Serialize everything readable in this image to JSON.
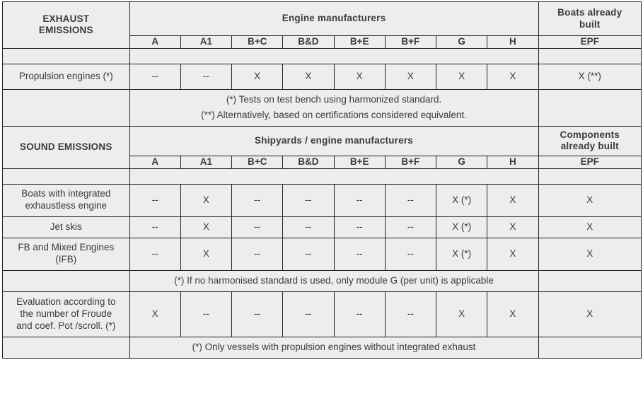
{
  "colors": {
    "header_green": "#2aa048",
    "cell_background": "#eceded",
    "border": "#231f20",
    "text": "#3b3b3b",
    "header_text": "#ffffff"
  },
  "modules": [
    "A",
    "A1",
    "B+C",
    "B&D",
    "B+E",
    "B+F",
    "G",
    "H"
  ],
  "already_built_module": "EPF",
  "section_exhaust": {
    "title": "EXHAUST\nEMISSIONS",
    "title_line1": "EXHAUST",
    "title_line2": "EMISSIONS",
    "group_header": "Engine manufacturers",
    "already_built_header_line1": "Boats already",
    "already_built_header_line2": "built",
    "rows": [
      {
        "label": "Propulsion engines (*)",
        "values": [
          "--",
          "--",
          "X",
          "X",
          "X",
          "X",
          "X",
          "X"
        ],
        "epf": "X (**)"
      }
    ],
    "notes": [
      "(*) Tests on test bench using harmonized standard.",
      "(**) Alternatively, based on certifications considered equivalent."
    ]
  },
  "section_sound": {
    "title": "SOUND EMISSIONS",
    "group_header": "Shipyards / engine manufacturers",
    "already_built_header_line1": "Components",
    "already_built_header_line2": "already built",
    "rows": [
      {
        "label_line1": "Boats with integrated",
        "label_line2": "exhaustless engine",
        "values": [
          "--",
          "X",
          "--",
          "--",
          "--",
          "--",
          "X (*)",
          "X"
        ],
        "epf": "X"
      },
      {
        "label_line1": "Jet skis",
        "label_line2": "",
        "values": [
          "--",
          "X",
          "--",
          "--",
          "--",
          "--",
          "X (*)",
          "X"
        ],
        "epf": "X"
      },
      {
        "label_line1": "FB and Mixed Engines",
        "label_line2": "(IFB)",
        "values": [
          "--",
          "X",
          "--",
          "--",
          "--",
          "--",
          "X (*)",
          "X"
        ],
        "epf": "X"
      }
    ],
    "note_mid": "(*) If no harmonised standard is used, only module G (per unit) is applicable",
    "row_froude": {
      "label_line1": "Evaluation according to",
      "label_line2": "the number of Froude",
      "label_line3": "and coef. Pot /scroll. (*)",
      "values": [
        "X",
        "--",
        "--",
        "--",
        "--",
        "--",
        "X",
        "X"
      ],
      "epf": "X"
    },
    "note_bottom": "(*) Only vessels with propulsion engines without integrated exhaust"
  }
}
